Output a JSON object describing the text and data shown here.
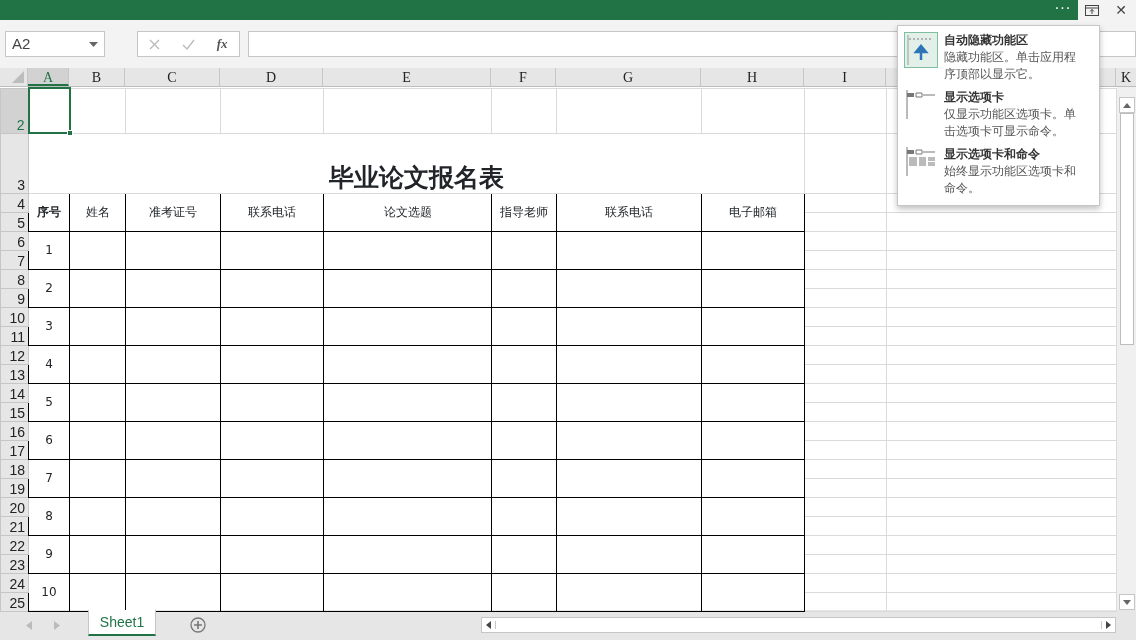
{
  "title_bar": {
    "more": "···",
    "ribbon_display_selected": true,
    "close": "✕"
  },
  "name_box": {
    "value": "A2"
  },
  "formula_bar": {
    "function_label": "fx"
  },
  "columns": [
    {
      "label": "A",
      "selected": true
    },
    {
      "label": "B",
      "selected": false
    },
    {
      "label": "C",
      "selected": false
    },
    {
      "label": "D",
      "selected": false
    },
    {
      "label": "E",
      "selected": false
    },
    {
      "label": "F",
      "selected": false
    },
    {
      "label": "G",
      "selected": false
    },
    {
      "label": "H",
      "selected": false
    },
    {
      "label": "I",
      "selected": false
    },
    {
      "label": "K",
      "selected": false
    }
  ],
  "rows": [
    {
      "label": "2",
      "selected": true
    },
    {
      "label": "3",
      "selected": false
    },
    {
      "label": "4",
      "selected": false
    },
    {
      "label": "5",
      "selected": false
    },
    {
      "label": "6",
      "selected": false
    },
    {
      "label": "7",
      "selected": false
    },
    {
      "label": "8",
      "selected": false
    },
    {
      "label": "9",
      "selected": false
    },
    {
      "label": "10",
      "selected": false
    },
    {
      "label": "11",
      "selected": false
    },
    {
      "label": "12",
      "selected": false
    },
    {
      "label": "13",
      "selected": false
    },
    {
      "label": "14",
      "selected": false
    },
    {
      "label": "15",
      "selected": false
    },
    {
      "label": "16",
      "selected": false
    },
    {
      "label": "17",
      "selected": false
    },
    {
      "label": "18",
      "selected": false
    },
    {
      "label": "19",
      "selected": false
    },
    {
      "label": "20",
      "selected": false
    },
    {
      "label": "21",
      "selected": false
    },
    {
      "label": "22",
      "selected": false
    },
    {
      "label": "23",
      "selected": false
    },
    {
      "label": "24",
      "selected": false
    },
    {
      "label": "25",
      "selected": false
    }
  ],
  "form": {
    "title": "毕业论文报名表",
    "headers": [
      {
        "text": "序号",
        "bold": true
      },
      {
        "text": "姓名",
        "bold": false
      },
      {
        "text": "准考证号",
        "bold": false
      },
      {
        "text": "联系电话",
        "bold": false
      },
      {
        "text": "论文选题",
        "bold": false
      },
      {
        "text": "指导老师",
        "bold": false
      },
      {
        "text": "联系电话",
        "bold": false
      },
      {
        "text": "电子邮箱",
        "bold": false
      }
    ],
    "records": [
      "1",
      "2",
      "3",
      "4",
      "5",
      "6",
      "7",
      "8",
      "9",
      "10"
    ]
  },
  "ribbon_menu": [
    {
      "kind": "auto_hide",
      "title": "自动隐藏功能区",
      "description": "隐藏功能区。单击应用程序顶部以显示它。",
      "selected": true
    },
    {
      "kind": "tabs",
      "title": "显示选项卡",
      "description": "仅显示功能区选项卡。单击选项卡可显示命令。",
      "selected": false
    },
    {
      "kind": "tabs_commands",
      "title": "显示选项卡和命令",
      "description": "始终显示功能区选项卡和命令。",
      "selected": false
    }
  ],
  "sheet_tabs": [
    {
      "label": "Sheet1",
      "selected": true
    }
  ]
}
